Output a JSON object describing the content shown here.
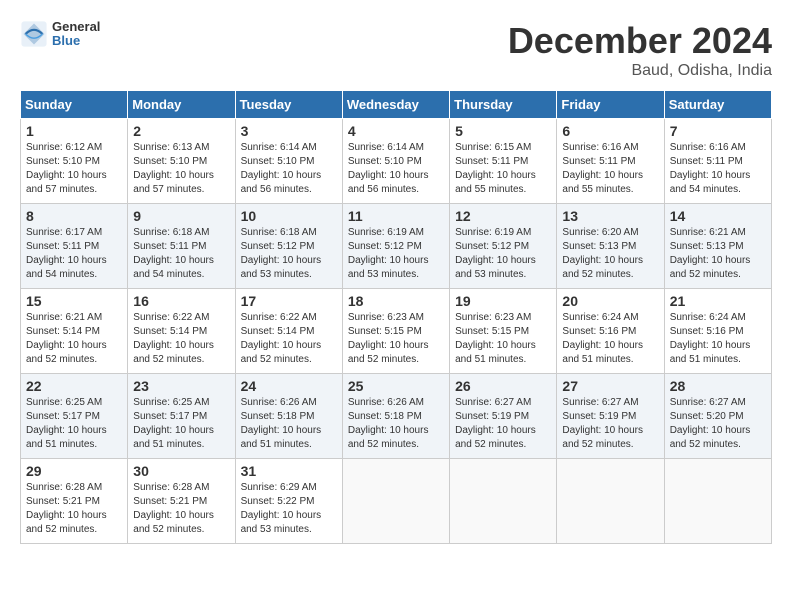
{
  "header": {
    "logo_line1": "General",
    "logo_line2": "Blue",
    "month": "December 2024",
    "location": "Baud, Odisha, India"
  },
  "weekdays": [
    "Sunday",
    "Monday",
    "Tuesday",
    "Wednesday",
    "Thursday",
    "Friday",
    "Saturday"
  ],
  "weeks": [
    [
      {
        "day": "1",
        "sunrise": "6:12 AM",
        "sunset": "5:10 PM",
        "daylight": "10 hours and 57 minutes."
      },
      {
        "day": "2",
        "sunrise": "6:13 AM",
        "sunset": "5:10 PM",
        "daylight": "10 hours and 57 minutes."
      },
      {
        "day": "3",
        "sunrise": "6:14 AM",
        "sunset": "5:10 PM",
        "daylight": "10 hours and 56 minutes."
      },
      {
        "day": "4",
        "sunrise": "6:14 AM",
        "sunset": "5:10 PM",
        "daylight": "10 hours and 56 minutes."
      },
      {
        "day": "5",
        "sunrise": "6:15 AM",
        "sunset": "5:11 PM",
        "daylight": "10 hours and 55 minutes."
      },
      {
        "day": "6",
        "sunrise": "6:16 AM",
        "sunset": "5:11 PM",
        "daylight": "10 hours and 55 minutes."
      },
      {
        "day": "7",
        "sunrise": "6:16 AM",
        "sunset": "5:11 PM",
        "daylight": "10 hours and 54 minutes."
      }
    ],
    [
      {
        "day": "8",
        "sunrise": "6:17 AM",
        "sunset": "5:11 PM",
        "daylight": "10 hours and 54 minutes."
      },
      {
        "day": "9",
        "sunrise": "6:18 AM",
        "sunset": "5:11 PM",
        "daylight": "10 hours and 54 minutes."
      },
      {
        "day": "10",
        "sunrise": "6:18 AM",
        "sunset": "5:12 PM",
        "daylight": "10 hours and 53 minutes."
      },
      {
        "day": "11",
        "sunrise": "6:19 AM",
        "sunset": "5:12 PM",
        "daylight": "10 hours and 53 minutes."
      },
      {
        "day": "12",
        "sunrise": "6:19 AM",
        "sunset": "5:12 PM",
        "daylight": "10 hours and 53 minutes."
      },
      {
        "day": "13",
        "sunrise": "6:20 AM",
        "sunset": "5:13 PM",
        "daylight": "10 hours and 52 minutes."
      },
      {
        "day": "14",
        "sunrise": "6:21 AM",
        "sunset": "5:13 PM",
        "daylight": "10 hours and 52 minutes."
      }
    ],
    [
      {
        "day": "15",
        "sunrise": "6:21 AM",
        "sunset": "5:14 PM",
        "daylight": "10 hours and 52 minutes."
      },
      {
        "day": "16",
        "sunrise": "6:22 AM",
        "sunset": "5:14 PM",
        "daylight": "10 hours and 52 minutes."
      },
      {
        "day": "17",
        "sunrise": "6:22 AM",
        "sunset": "5:14 PM",
        "daylight": "10 hours and 52 minutes."
      },
      {
        "day": "18",
        "sunrise": "6:23 AM",
        "sunset": "5:15 PM",
        "daylight": "10 hours and 52 minutes."
      },
      {
        "day": "19",
        "sunrise": "6:23 AM",
        "sunset": "5:15 PM",
        "daylight": "10 hours and 51 minutes."
      },
      {
        "day": "20",
        "sunrise": "6:24 AM",
        "sunset": "5:16 PM",
        "daylight": "10 hours and 51 minutes."
      },
      {
        "day": "21",
        "sunrise": "6:24 AM",
        "sunset": "5:16 PM",
        "daylight": "10 hours and 51 minutes."
      }
    ],
    [
      {
        "day": "22",
        "sunrise": "6:25 AM",
        "sunset": "5:17 PM",
        "daylight": "10 hours and 51 minutes."
      },
      {
        "day": "23",
        "sunrise": "6:25 AM",
        "sunset": "5:17 PM",
        "daylight": "10 hours and 51 minutes."
      },
      {
        "day": "24",
        "sunrise": "6:26 AM",
        "sunset": "5:18 PM",
        "daylight": "10 hours and 51 minutes."
      },
      {
        "day": "25",
        "sunrise": "6:26 AM",
        "sunset": "5:18 PM",
        "daylight": "10 hours and 52 minutes."
      },
      {
        "day": "26",
        "sunrise": "6:27 AM",
        "sunset": "5:19 PM",
        "daylight": "10 hours and 52 minutes."
      },
      {
        "day": "27",
        "sunrise": "6:27 AM",
        "sunset": "5:19 PM",
        "daylight": "10 hours and 52 minutes."
      },
      {
        "day": "28",
        "sunrise": "6:27 AM",
        "sunset": "5:20 PM",
        "daylight": "10 hours and 52 minutes."
      }
    ],
    [
      {
        "day": "29",
        "sunrise": "6:28 AM",
        "sunset": "5:21 PM",
        "daylight": "10 hours and 52 minutes."
      },
      {
        "day": "30",
        "sunrise": "6:28 AM",
        "sunset": "5:21 PM",
        "daylight": "10 hours and 52 minutes."
      },
      {
        "day": "31",
        "sunrise": "6:29 AM",
        "sunset": "5:22 PM",
        "daylight": "10 hours and 53 minutes."
      },
      null,
      null,
      null,
      null
    ]
  ]
}
